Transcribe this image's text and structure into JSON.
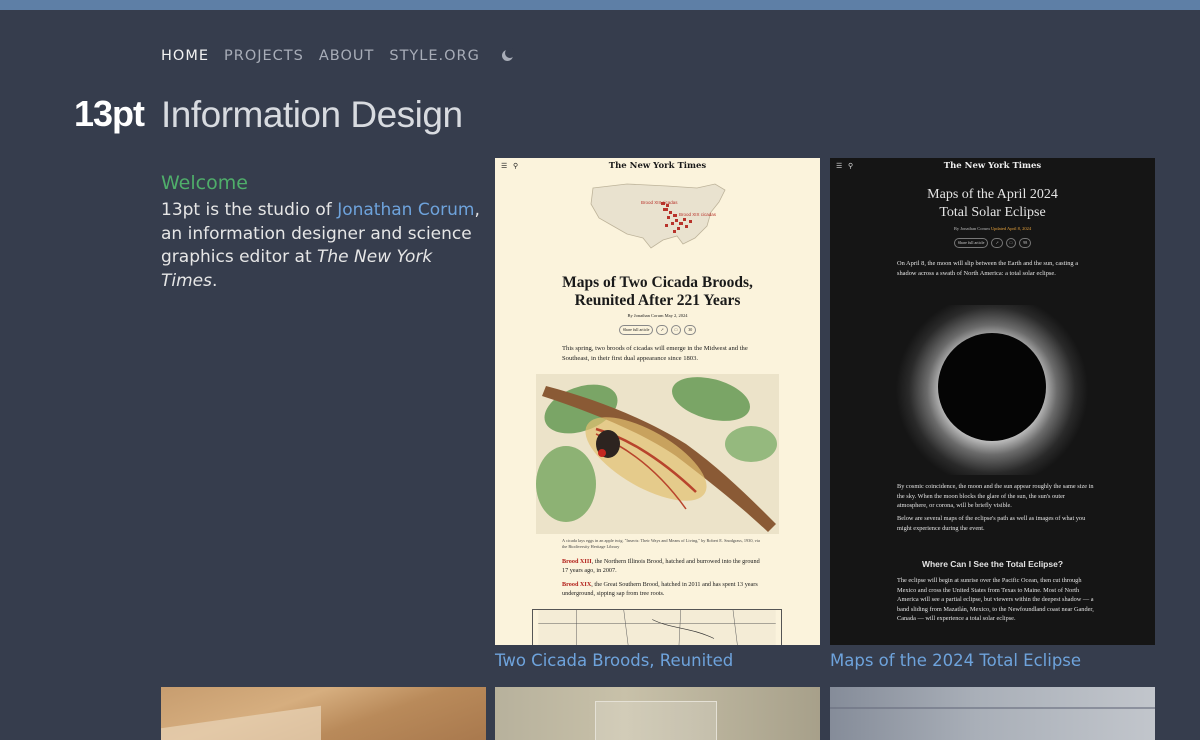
{
  "nav": {
    "items": [
      "HOME",
      "PROJECTS",
      "ABOUT",
      "STYLE.ORG"
    ],
    "theme_icon": "moon-icon"
  },
  "logo": "13pt",
  "site_title": "Information Design",
  "welcome": {
    "heading": "Welcome",
    "text_before": "13pt is the studio of ",
    "link": "Jonathan Corum",
    "text_middle": ", an information designer and science graphics editor at ",
    "publication": "The New York Times",
    "text_after": "."
  },
  "projects": [
    {
      "caption": "Two Cicada Broods, Reunited",
      "thumb": {
        "masthead": "The New York Times",
        "map_labels": [
          "Brood XIII cicadas",
          "Brood XIX cicadas"
        ],
        "headline_1": "Maps of Two Cicada Broods,",
        "headline_2": "Reunited After 221 Years",
        "byline": "By Jonathan Corum   May 2, 2024",
        "pills": [
          "Share full article",
          "↗",
          "□",
          "30"
        ],
        "lede": "This spring, two broods of cicadas will emerge in the Midwest and the Southeast, in their first dual appearance since 1803.",
        "credit": "A cicada lays eggs in an apple twig.  \"Insects: Their Ways and Means of Living,\" by Robert E. Snodgrass, 1930, via the Biodiversity Heritage Library",
        "p1_brood": "Brood XIII",
        "p1": ", the Northern Illinois Brood, hatched and burrowed into the ground 17 years ago, in 2007.",
        "p2_brood": "Brood XIX",
        "p2": ", the Great Southern Brood, hatched in 2011 and has spent 13 years underground, sipping sap from tree roots."
      }
    },
    {
      "caption": "Maps of the 2024 Total Eclipse",
      "thumb": {
        "masthead": "The New York Times",
        "headline_1": "Maps of the April 2024",
        "headline_2": "Total Solar Eclipse",
        "byline": "By Jonathan Corum",
        "updated": "Updated April 8, 2024",
        "pills": [
          "Share full article",
          "↗",
          "□",
          "98"
        ],
        "lede": "On April 8, the moon will slip between the Earth and the sun, casting a shadow across a swath of North America: a total solar eclipse.",
        "p1": "By cosmic coincidence, the moon and the sun appear roughly the same size in the sky. When the moon blocks the glare of the sun, the sun's outer atmosphere, or corona, will be briefly visible.",
        "p2": "Below are several maps of the eclipse's path as well as images of what you might experience during the event.",
        "subhead": "Where Can I See the Total Eclipse?",
        "p3": "The eclipse will begin at sunrise over the Pacific Ocean, then cut through Mexico and cross the United States from Texas to Maine. Most of North America will see a partial eclipse, but viewers within the deepest shadow — a band sliding from Mazatlán, Mexico, to the Newfoundland coast near Gander, Canada — will experience a total solar eclipse."
      }
    }
  ]
}
